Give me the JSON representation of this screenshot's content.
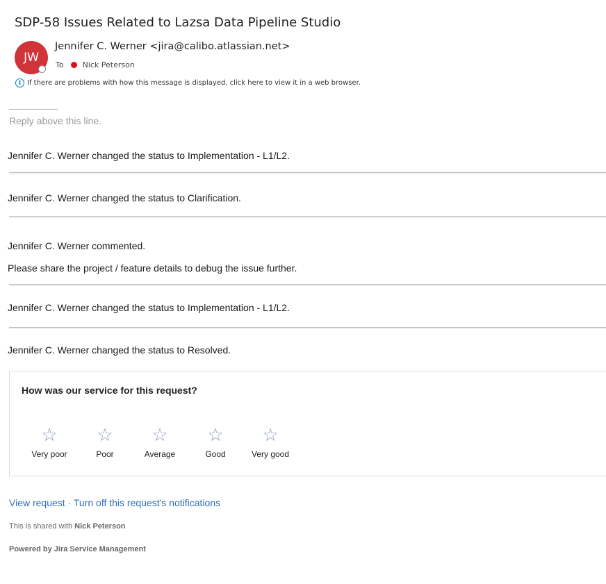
{
  "email": {
    "subject": "SDP-58 Issues Related to Lazsa Data Pipeline Studio",
    "avatar_initials": "JW",
    "sender": "Jennifer C. Werner <jira@calibo.atlassian.net>",
    "to_label": "To",
    "recipient": "Nick Peterson",
    "info_bar": "If there are problems with how this message is displayed, click here to view it in a web browser.",
    "info_icon": "info-icon"
  },
  "body": {
    "reply_hint": "Reply above this line.",
    "activities": [
      "Jennifer C. Werner changed the status to Implementation - L1/L2.",
      "Jennifer C. Werner changed the status to Clarification.",
      "Jennifer C. Werner commented.",
      "Please share the project / feature details to debug the issue further.",
      "Jennifer C. Werner changed the status to Implementation - L1/L2.",
      "Jennifer C. Werner changed the status to Resolved."
    ]
  },
  "survey": {
    "question": "How was our service for this request?",
    "star_icon": "star-outline-icon",
    "ratings": [
      "Very poor",
      "Poor",
      "Average",
      "Good",
      "Very good"
    ]
  },
  "footer": {
    "view_request": "View request",
    "separator": "·",
    "turn_off": "Turn off this request's notifications",
    "shared_prefix": "This is shared with",
    "shared_name": "Nick Peterson",
    "powered_by": "Powered by Jira Service Management"
  },
  "colors": {
    "avatar": "#d13438",
    "link": "#2a6ebb",
    "recipient_dot": "#e00b1c"
  }
}
